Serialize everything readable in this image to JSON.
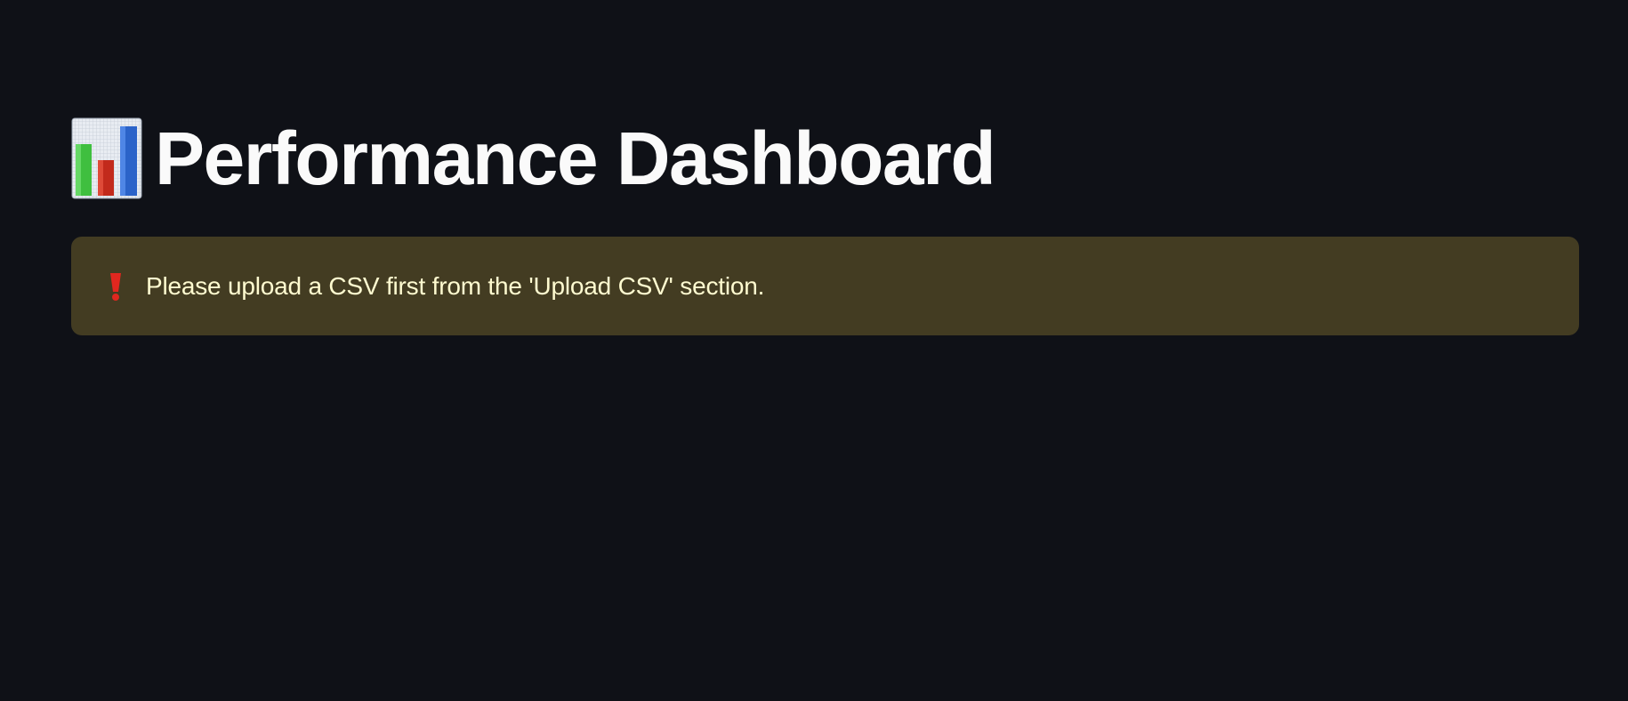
{
  "page": {
    "background": "#0f1117",
    "title": "Performance Dashboard",
    "title_icon": "bar-chart-icon",
    "title_color": "#fafafa"
  },
  "alert": {
    "kind": "warning",
    "icon": "exclamation-icon",
    "message": "Please upload a CSV first from the 'Upload CSV' section.",
    "background": "#433c22",
    "text_color": "#fffbd0",
    "icon_color": "#e0271f"
  }
}
